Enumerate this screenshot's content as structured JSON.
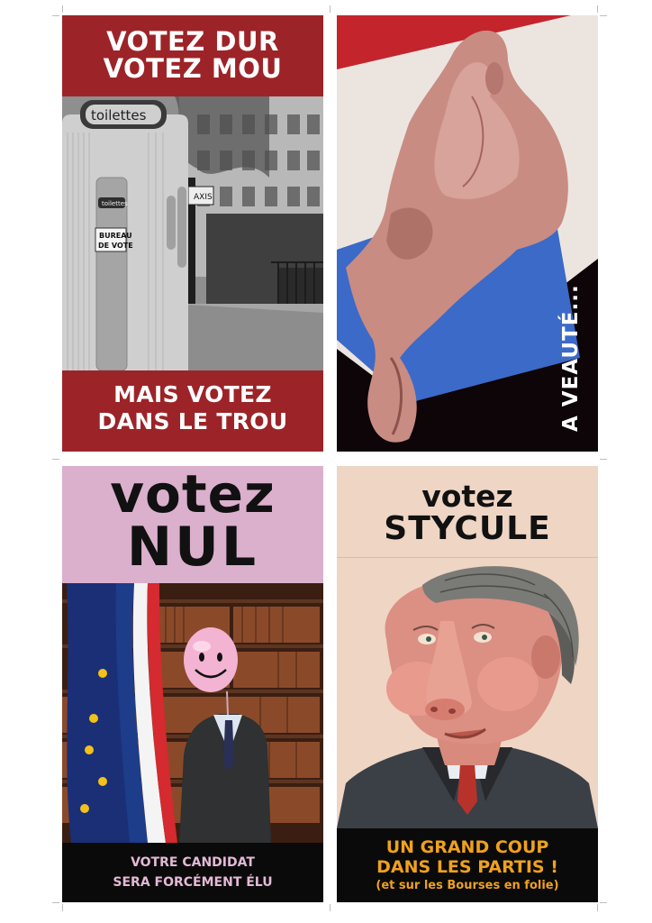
{
  "posters": [
    {
      "headline_line1": "VOTEZ DUR",
      "headline_line2": "VOTEZ MOU",
      "photo_sign_top": "toilettes",
      "photo_sign_small": "toilettes",
      "photo_sign_bureau_line1": "BUREAU",
      "photo_sign_bureau_line2": "DE VOTE",
      "photo_sign_taxis": "AXIS",
      "footer_line1": "MAIS VOTEZ",
      "footer_line2": "DANS LE TROU"
    },
    {
      "vertical_text": "A VEAUTÉ..."
    },
    {
      "headline_line1": "votez",
      "headline_line2": "NUL",
      "footer_line1": "VOTRE CANDIDAT",
      "footer_line2": "SERA FORCÉMENT ÉLU"
    },
    {
      "headline_line1": "votez",
      "headline_line2": "STYCULE",
      "footer_line1": "UN GRAND COUP",
      "footer_line2": "DANS LES PARTIS !",
      "footer_line3": "(et sur les Bourses en folie)"
    }
  ],
  "colors": {
    "poster1_red": "#9c2428",
    "poster3_pink": "#dbb0cd",
    "poster4_beige": "#eed5c4",
    "footer_orange": "#f0a11d",
    "tricolor_blue": "#3b6ac8",
    "tricolor_red": "#c4242c"
  },
  "icons": [
    "calf-head-image",
    "smiley-balloon-icon",
    "eu-flag-icon",
    "french-flag-icon",
    "caricature-portrait"
  ]
}
